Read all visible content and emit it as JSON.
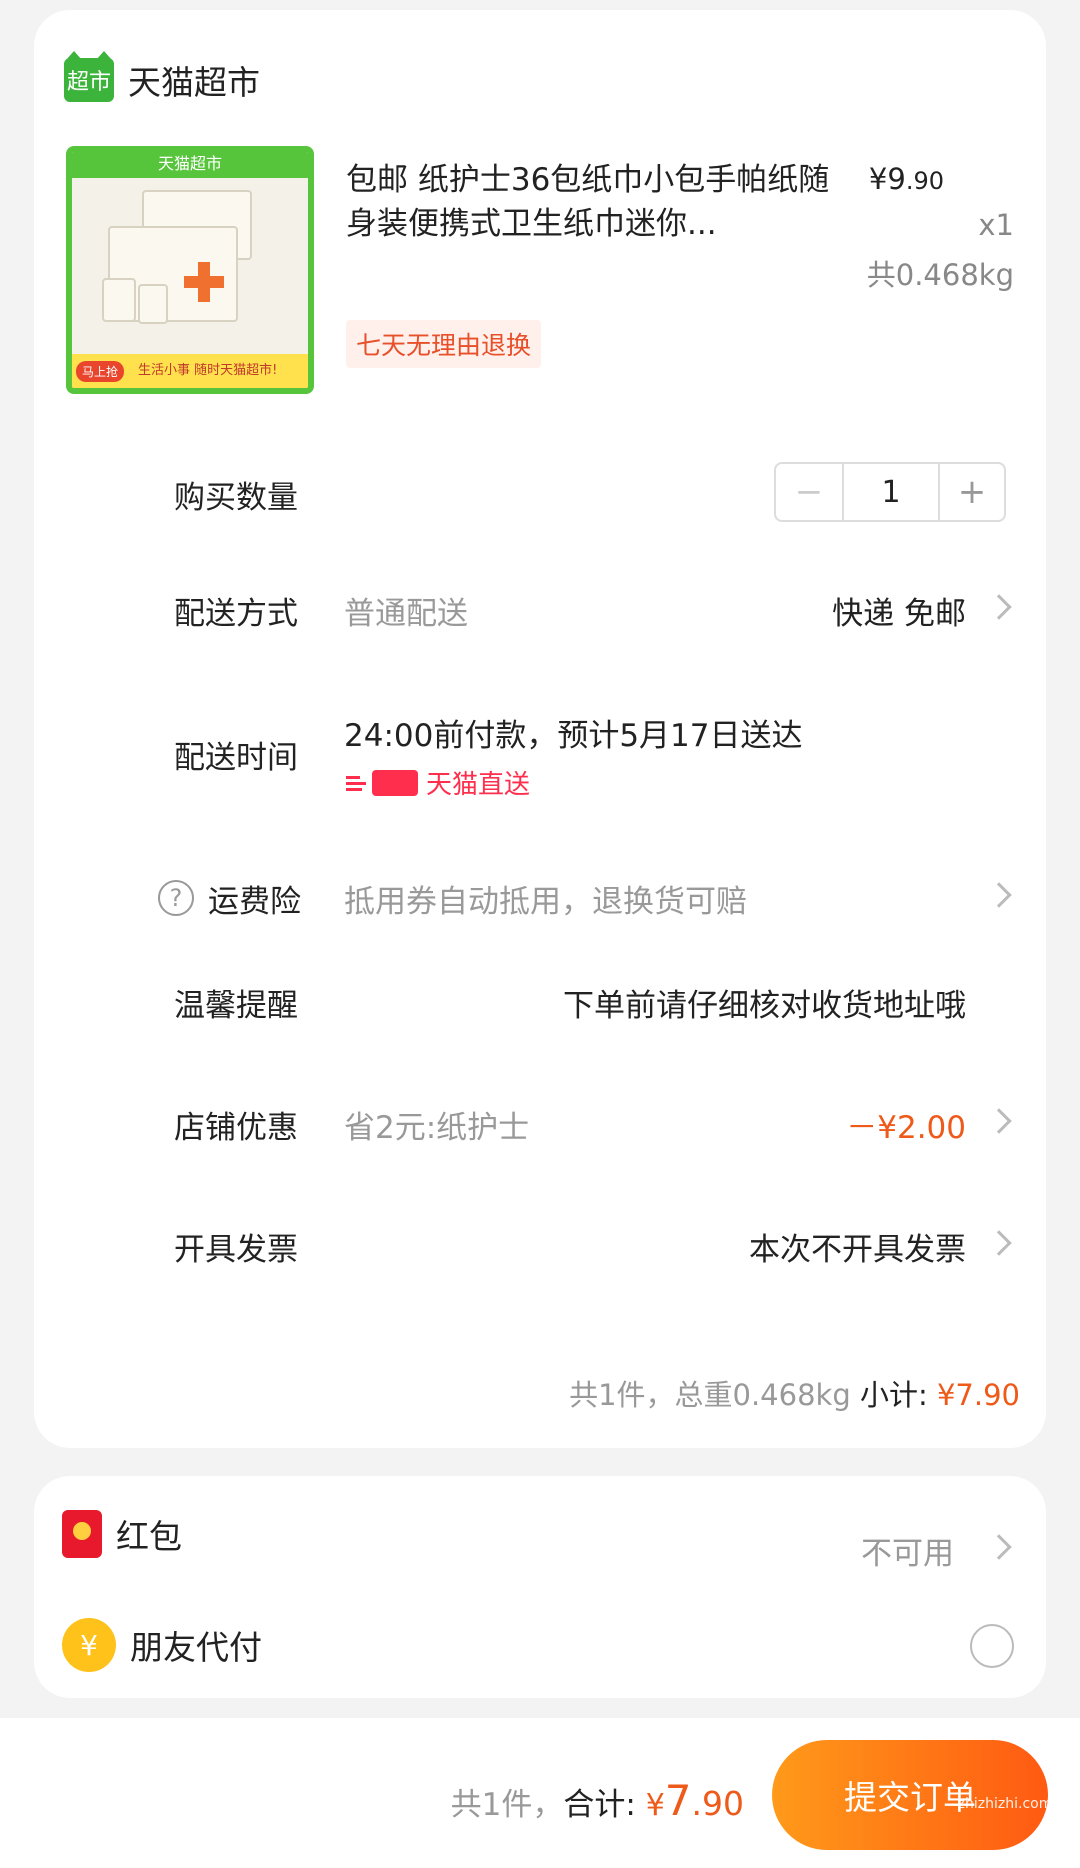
{
  "store": {
    "logo_text": "超市",
    "name": "天猫超市"
  },
  "product": {
    "image_banner": "天猫超市",
    "image_footer": "生活小事 随时天猫超市!",
    "image_grab": "马上抢",
    "title": "包邮 纸护士36包纸巾小包手帕纸随身装便携式卫生纸巾迷你...",
    "price_int": "¥9",
    "price_dec": ".90",
    "quantity": "x1",
    "weight": "共0.468kg",
    "return_tag": "七天无理由退换"
  },
  "rows": {
    "buy_qty_label": "购买数量",
    "qty_value": "1",
    "qty_minus": "−",
    "qty_plus": "+",
    "shipping_label": "配送方式",
    "shipping_value": "普通配送",
    "shipping_right": "快递 免邮",
    "time_label": "配送时间",
    "time_value": "24:00前付款，预计5月17日送达",
    "direct_label": "天猫直送",
    "insurance_label": "运费险",
    "insurance_value": "抵用券自动抵用，退换货可赔",
    "reminder_label": "温馨提醒",
    "reminder_value": "下单前请仔细核对收货地址哦",
    "store_discount_label": "店铺优惠",
    "store_discount_value": "省2元:纸护士",
    "store_discount_amount": "－¥2.00",
    "invoice_label": "开具发票",
    "invoice_value": "本次不开具发票"
  },
  "summary": {
    "count": "共1件，总重0.468kg",
    "label": "小计:",
    "amount": "¥7.90"
  },
  "payment": {
    "hongbao_label": "红包",
    "hongbao_value": "不可用",
    "friend_label": "朋友代付",
    "friend_icon": "¥"
  },
  "bottom": {
    "count": "共1件，",
    "total_label": "合计:",
    "currency": "¥",
    "total_int": "7",
    "total_dec": ".90",
    "submit_label": "提交订单",
    "watermark": "zhizhizhi.com"
  },
  "colors": {
    "accent": "#ee5a1a",
    "tmall_green": "#3cb43c",
    "tmall_red": "#ff2e4d"
  }
}
